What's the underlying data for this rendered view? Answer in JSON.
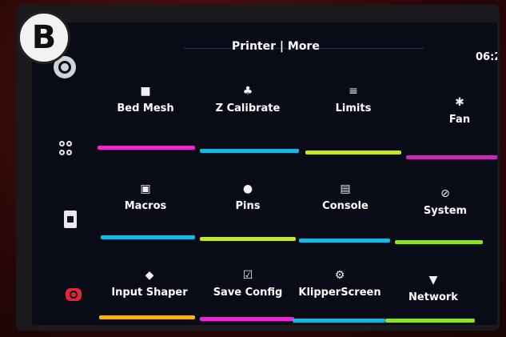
{
  "badge": "B",
  "header": {
    "title": "Printer | More",
    "time": "06:2"
  },
  "sidebar": [
    {
      "name": "back-icon"
    },
    {
      "name": "main-menu-icon"
    },
    {
      "name": "macros-file-icon"
    },
    {
      "name": "emergency-stop-icon"
    }
  ],
  "tiles": [
    {
      "label": "Bed Mesh",
      "icon": "■",
      "icon_name": "bed-mesh-icon",
      "color": "#e62ad0"
    },
    {
      "label": "Z Calibrate",
      "icon": "♣",
      "icon_name": "z-calibrate-icon",
      "color": "#18b7e0"
    },
    {
      "label": "Limits",
      "icon": "≡",
      "icon_name": "limits-icon",
      "color": "#c6e52a"
    },
    {
      "label": "Fan",
      "icon": "✱",
      "icon_name": "fan-icon",
      "color": "#c42cb8"
    },
    {
      "label": "Macros",
      "icon": "▣",
      "icon_name": "macros-icon",
      "color": "#18b7e0"
    },
    {
      "label": "Pins",
      "icon": "●",
      "icon_name": "pins-icon",
      "color": "#c6e52a"
    },
    {
      "label": "Console",
      "icon": "▤",
      "icon_name": "console-icon",
      "color": "#18b7e0"
    },
    {
      "label": "System",
      "icon": "⊘",
      "icon_name": "system-icon",
      "color": "#8ee02a"
    },
    {
      "label": "Input Shaper",
      "icon": "◆",
      "icon_name": "input-shaper-icon",
      "color": "#f2b21c"
    },
    {
      "label": "Save Config",
      "icon": "☑",
      "icon_name": "save-config-icon",
      "color": "#e62ad0"
    },
    {
      "label": "KlipperScreen",
      "icon": "⚙",
      "icon_name": "klipperscreen-icon",
      "color": "#18b7e0"
    },
    {
      "label": "Network",
      "icon": "▼",
      "icon_name": "network-icon",
      "color": "#8ee02a"
    }
  ]
}
